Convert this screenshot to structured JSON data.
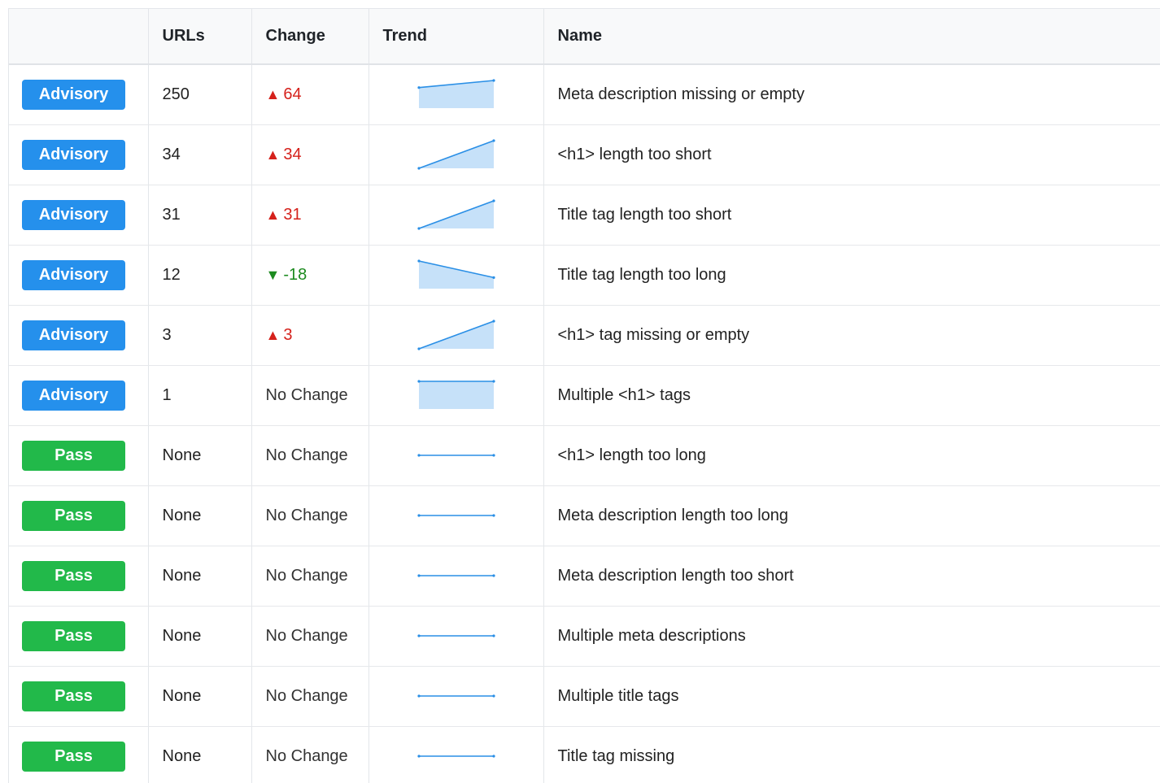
{
  "table": {
    "headers": {
      "status": "",
      "urls": "URLs",
      "change": "Change",
      "trend": "Trend",
      "name": "Name"
    },
    "rows": [
      {
        "status": "Advisory",
        "status_type": "advisory",
        "urls": "250",
        "change": "64",
        "direction": "up",
        "arrow": "▲",
        "trend": [
          186,
          250
        ],
        "name": "Meta description missing or empty"
      },
      {
        "status": "Advisory",
        "status_type": "advisory",
        "urls": "34",
        "change": "34",
        "direction": "up",
        "arrow": "▲",
        "trend": [
          0,
          34
        ],
        "name": "<h1> length too short"
      },
      {
        "status": "Advisory",
        "status_type": "advisory",
        "urls": "31",
        "change": "31",
        "direction": "up",
        "arrow": "▲",
        "trend": [
          0,
          31
        ],
        "name": "Title tag length too short"
      },
      {
        "status": "Advisory",
        "status_type": "advisory",
        "urls": "12",
        "change": "-18",
        "direction": "down",
        "arrow": "▼",
        "trend": [
          30,
          12
        ],
        "name": "Title tag length too long"
      },
      {
        "status": "Advisory",
        "status_type": "advisory",
        "urls": "3",
        "change": "3",
        "direction": "up",
        "arrow": "▲",
        "trend": [
          0,
          3
        ],
        "name": "<h1> tag missing or empty"
      },
      {
        "status": "Advisory",
        "status_type": "advisory",
        "urls": "1",
        "change": "No Change",
        "direction": "none",
        "arrow": "",
        "trend": [
          1,
          1
        ],
        "name": "Multiple <h1> tags"
      },
      {
        "status": "Pass",
        "status_type": "pass",
        "urls": "None",
        "change": "No Change",
        "direction": "none",
        "arrow": "",
        "trend": [
          0,
          0
        ],
        "name": "<h1> length too long"
      },
      {
        "status": "Pass",
        "status_type": "pass",
        "urls": "None",
        "change": "No Change",
        "direction": "none",
        "arrow": "",
        "trend": [
          0,
          0
        ],
        "name": "Meta description length too long"
      },
      {
        "status": "Pass",
        "status_type": "pass",
        "urls": "None",
        "change": "No Change",
        "direction": "none",
        "arrow": "",
        "trend": [
          0,
          0
        ],
        "name": "Meta description length too short"
      },
      {
        "status": "Pass",
        "status_type": "pass",
        "urls": "None",
        "change": "No Change",
        "direction": "none",
        "arrow": "",
        "trend": [
          0,
          0
        ],
        "name": "Multiple meta descriptions"
      },
      {
        "status": "Pass",
        "status_type": "pass",
        "urls": "None",
        "change": "No Change",
        "direction": "none",
        "arrow": "",
        "trend": [
          0,
          0
        ],
        "name": "Multiple title tags"
      },
      {
        "status": "Pass",
        "status_type": "pass",
        "urls": "None",
        "change": "No Change",
        "direction": "none",
        "arrow": "",
        "trend": [
          0,
          0
        ],
        "name": "Title tag missing"
      }
    ]
  },
  "colors": {
    "advisory": "#2590ec",
    "pass": "#22b94a",
    "up": "#d5211b",
    "down": "#1c8a1f",
    "spark_line": "#2a8fe6",
    "spark_fill": "#c6e1f9"
  }
}
